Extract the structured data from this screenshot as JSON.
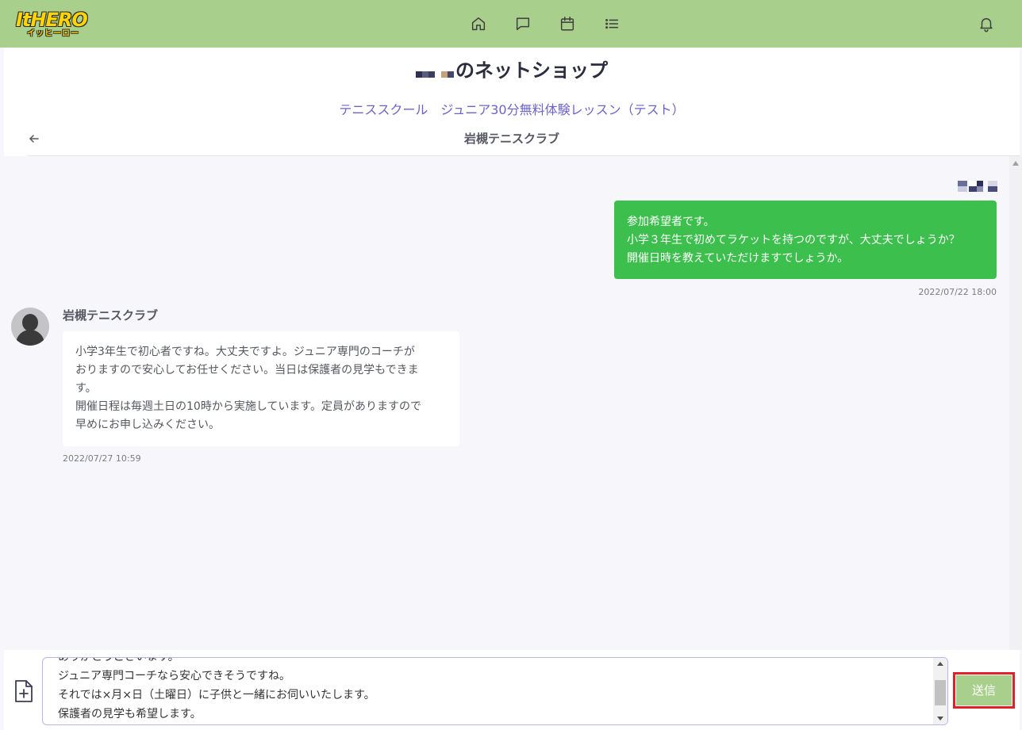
{
  "app": {
    "logo_text": "ItHERO",
    "logo_subtext": "イッヒーロー"
  },
  "nav": {
    "icons": [
      "home-icon",
      "chat-icon",
      "calendar-icon",
      "list-icon"
    ],
    "bell_icon": "bell-icon"
  },
  "header": {
    "shop_name": "のネットショップ",
    "course_title": "テニススクール　ジュニア30分無料体験レッスン（テスト）",
    "club_name": "岩槻テニスクラブ"
  },
  "messages": {
    "outgoing": {
      "lines": [
        "参加希望者です。",
        "小学３年生で初めてラケットを持つのですが、大丈夫でしょうか？",
        "開催日時を教えていただけますでしょうか。"
      ],
      "timestamp": "2022/07/22 18:00"
    },
    "incoming": {
      "sender": "岩槻テニスクラブ",
      "lines": [
        "小学3年生で初心者ですね。大丈夫ですよ。ジュニア専門のコーチが",
        "おりますので安心してお任せください。当日は保護者の見学もできま",
        "す。",
        "開催日程は毎週土日の10時から実施しています。定員がありますので",
        "早めにお申し込みください。"
      ],
      "timestamp": "2022/07/27 10:59"
    }
  },
  "composer": {
    "lines": [
      "ありがとうございます。",
      "ジュニア専門コーチなら安心できそうですね。",
      "それでは×月×日（土曜日）に子供と一緒にお伺いいたします。",
      "保護者の見学も希望します。"
    ],
    "send_label": "送信"
  },
  "colors": {
    "topbar": "#a8cf8c",
    "outgoing_bubble": "#3cbf4c",
    "link": "#6b63c9",
    "highlight": "#e0212a"
  }
}
